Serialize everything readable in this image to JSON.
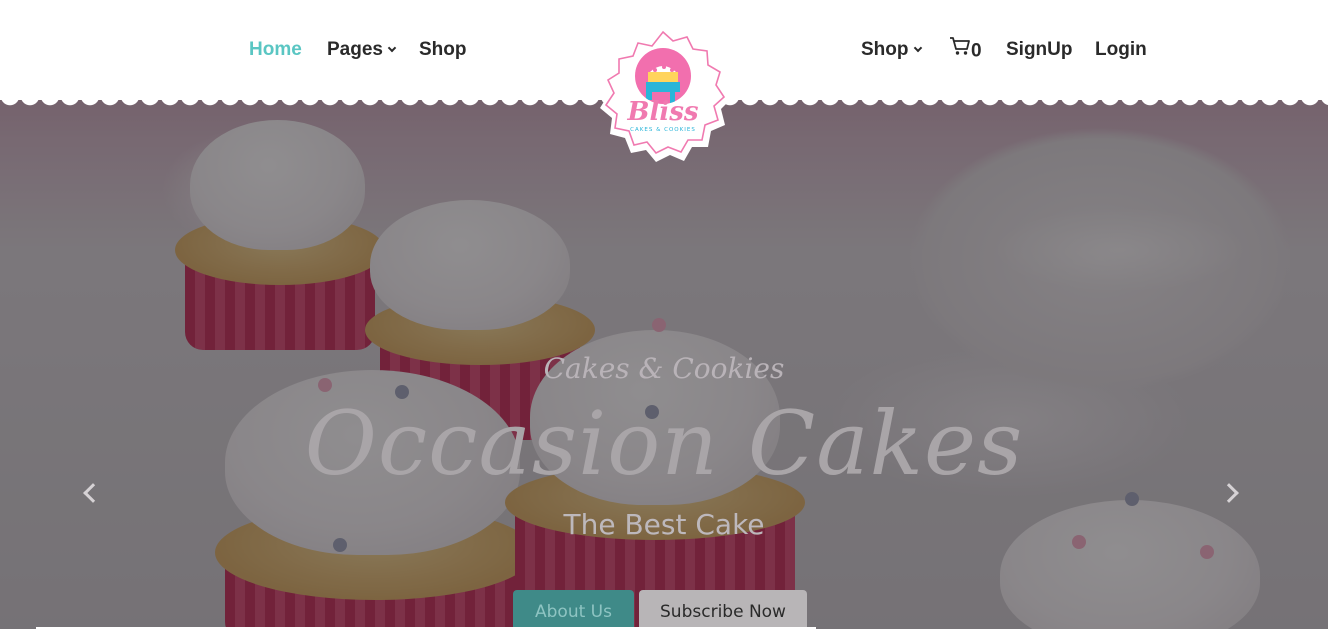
{
  "nav_left": {
    "home_label": "Home",
    "pages_label": "Pages",
    "shop_label": "Shop"
  },
  "nav_right": {
    "shop_label": "Shop",
    "cart_count": "0",
    "signup_label": "SignUp",
    "login_label": "Login"
  },
  "logo": {
    "brand": "Bliss",
    "tagline": "CAKES & COOKIES"
  },
  "hero": {
    "subtitle": "Cakes & Cookies",
    "headline": "Occasion Cakes",
    "tagline": "The Best Cake",
    "about_button": "About Us",
    "subscribe_button": "Subscribe Now"
  },
  "colors": {
    "accent": "#5ac6c3",
    "brand_pink": "#f07ab0",
    "about_button_bg": "#3f8a88"
  },
  "icons": [
    "chevron-down-icon",
    "cart-icon",
    "arrow-left-icon",
    "arrow-right-icon"
  ]
}
